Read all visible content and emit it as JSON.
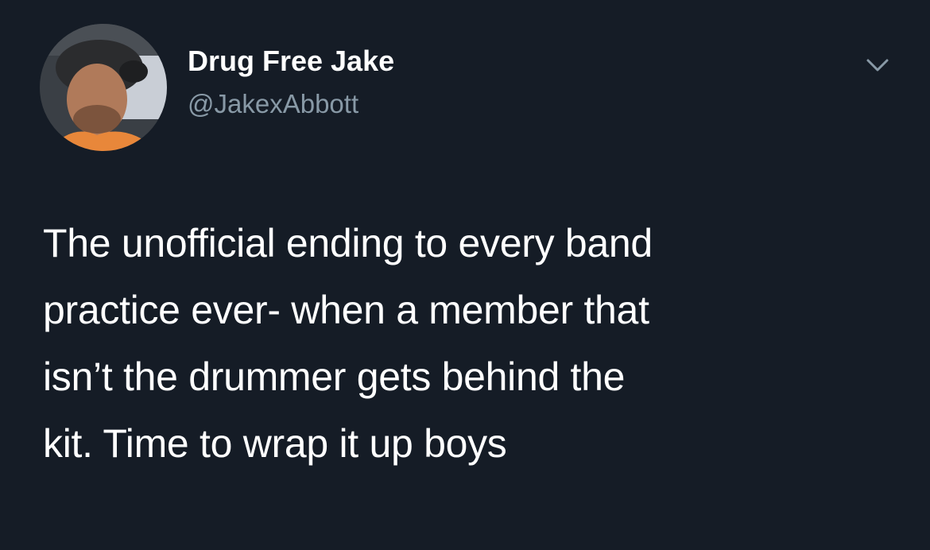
{
  "author": {
    "display_name": "Drug Free Jake",
    "handle": "@JakexAbbott",
    "avatar_icon": "profile-photo"
  },
  "tweet": {
    "text": "The unofficial ending to every band\npractice ever- when a member that\nisn’t the drummer gets behind the\nkit. Time to wrap it up boys"
  },
  "menu": {
    "icon": "chevron-down-icon"
  },
  "colors": {
    "background": "#151c26",
    "text": "#ffffff",
    "secondary_text": "#8899a6"
  }
}
